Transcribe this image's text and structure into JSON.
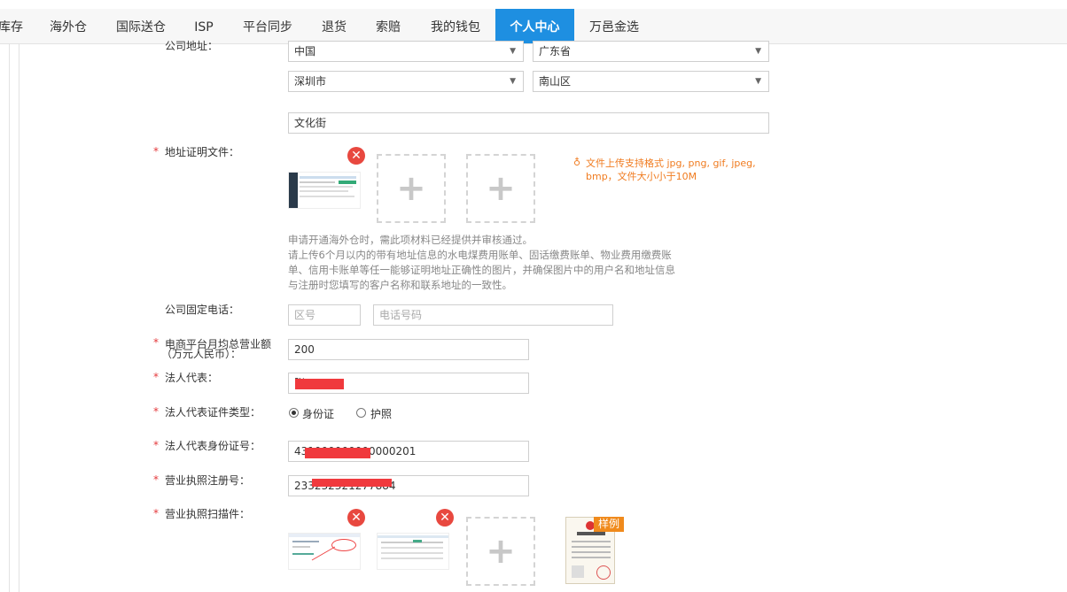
{
  "nav": {
    "items": [
      "库存",
      "海外仓",
      "国际送仓",
      "ISP",
      "平台同步",
      "退货",
      "索赔",
      "我的钱包",
      "个人中心",
      "万邑金选"
    ],
    "active": "个人中心"
  },
  "address": {
    "label": "公司地址：",
    "country": "中国",
    "province": "广东省",
    "city": "深圳市",
    "district": "南山区",
    "street": "文化街"
  },
  "proof": {
    "label": "地址证明文件：",
    "hint": "文件上传支持格式 jpg, png, gif, jpeg, bmp，文件大小小于10M",
    "note_1": "申请开通海外仓时，需此项材料已经提供并审核通过。",
    "note_2": "请上传6个月以内的带有地址信息的水电煤费用账单、固话缴费账单、物业费用缴费账单、信用卡账单等任一能够证明地址正确性的图片，并确保图片中的用户名和地址信息与注册时您填写的客户名称和联系地址的一致性。"
  },
  "phone": {
    "label": "公司固定电话：",
    "area_placeholder": "区号",
    "number_placeholder": "电话号码"
  },
  "revenue": {
    "label_line1": "电商平台月均总营业额",
    "label_line2": "（万元人民币）：",
    "value": "200"
  },
  "legal_rep": {
    "label": "法人代表：",
    "value": "张"
  },
  "id_type": {
    "label": "法人代表证件类型：",
    "option_id": "身份证",
    "option_passport": "护照"
  },
  "id_number": {
    "label": "法人代表身份证号：",
    "value": "431000000000000201"
  },
  "license_no": {
    "label": "营业执照注册号：",
    "value": "233232321277884"
  },
  "license_scan": {
    "label": "营业执照扫描件：",
    "sample_badge": "样例"
  },
  "required_mark": "*"
}
